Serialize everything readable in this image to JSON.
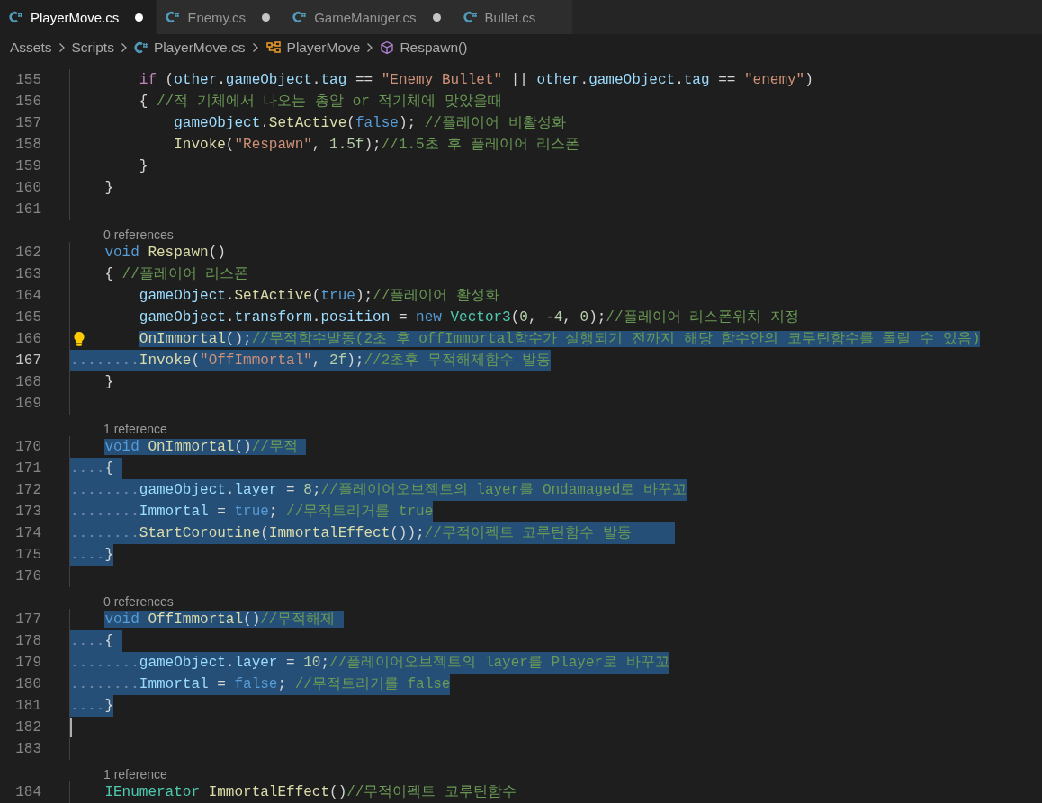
{
  "tabs": [
    {
      "label": "PlayerMove.cs",
      "selected": true,
      "modified": true
    },
    {
      "label": "Enemy.cs",
      "selected": false,
      "modified": true
    },
    {
      "label": "GameManiger.cs",
      "selected": false,
      "modified": true
    },
    {
      "label": "Bullet.cs",
      "selected": false,
      "modified": false
    }
  ],
  "breadcrumb": [
    {
      "kind": "folder",
      "label": "Assets"
    },
    {
      "kind": "folder",
      "label": "Scripts"
    },
    {
      "kind": "file",
      "label": "PlayerMove.cs"
    },
    {
      "kind": "class",
      "label": "PlayerMove"
    },
    {
      "kind": "method",
      "label": "Respawn()"
    }
  ],
  "editor": {
    "rows": [
      {
        "kind": "code",
        "number": "155",
        "selected": false,
        "active": false,
        "cursor": false,
        "lightbulb": false,
        "tokens": [
          {
            "text": "        if",
            "kind": "ctl"
          },
          {
            "text": " (",
            "kind": "p"
          },
          {
            "text": "other",
            "kind": "var"
          },
          {
            "text": ".",
            "kind": "p"
          },
          {
            "text": "gameObject",
            "kind": "var"
          },
          {
            "text": ".",
            "kind": "p"
          },
          {
            "text": "tag",
            "kind": "var"
          },
          {
            "text": " == ",
            "kind": "p"
          },
          {
            "text": "\"Enemy_Bullet\"",
            "kind": "str"
          },
          {
            "text": " || ",
            "kind": "p"
          },
          {
            "text": "other",
            "kind": "var"
          },
          {
            "text": ".",
            "kind": "p"
          },
          {
            "text": "gameObject",
            "kind": "var"
          },
          {
            "text": ".",
            "kind": "p"
          },
          {
            "text": "tag",
            "kind": "var"
          },
          {
            "text": " == ",
            "kind": "p"
          },
          {
            "text": "\"enemy\"",
            "kind": "str"
          },
          {
            "text": ")",
            "kind": "p"
          }
        ]
      },
      {
        "kind": "code",
        "number": "156",
        "selected": false,
        "active": false,
        "cursor": false,
        "lightbulb": false,
        "tokens": [
          {
            "text": "        { ",
            "kind": "p"
          },
          {
            "text": "//적 기체에서 나오는 총알 or 적기체에 맞았을때",
            "kind": "cmt"
          }
        ]
      },
      {
        "kind": "code",
        "number": "157",
        "selected": false,
        "active": false,
        "cursor": false,
        "lightbulb": false,
        "tokens": [
          {
            "text": "            gameObject",
            "kind": "var"
          },
          {
            "text": ".",
            "kind": "p"
          },
          {
            "text": "SetActive",
            "kind": "fn"
          },
          {
            "text": "(",
            "kind": "p"
          },
          {
            "text": "false",
            "kind": "kw"
          },
          {
            "text": "); ",
            "kind": "p"
          },
          {
            "text": "//플레이어 비활성화",
            "kind": "cmt"
          }
        ]
      },
      {
        "kind": "code",
        "number": "158",
        "selected": false,
        "active": false,
        "cursor": false,
        "lightbulb": false,
        "tokens": [
          {
            "text": "            Invoke",
            "kind": "fn"
          },
          {
            "text": "(",
            "kind": "p"
          },
          {
            "text": "\"Respawn\"",
            "kind": "str"
          },
          {
            "text": ", ",
            "kind": "p"
          },
          {
            "text": "1.5f",
            "kind": "num"
          },
          {
            "text": ");",
            "kind": "p"
          },
          {
            "text": "//1.5초 후 플레이어 리스폰",
            "kind": "cmt"
          }
        ]
      },
      {
        "kind": "code",
        "number": "159",
        "selected": false,
        "active": false,
        "cursor": false,
        "lightbulb": false,
        "tokens": [
          {
            "text": "        }",
            "kind": "p"
          }
        ]
      },
      {
        "kind": "code",
        "number": "160",
        "selected": false,
        "active": false,
        "cursor": false,
        "lightbulb": false,
        "tokens": [
          {
            "text": "    }",
            "kind": "p"
          }
        ]
      },
      {
        "kind": "code",
        "number": "161",
        "active": false,
        "cursor": false,
        "lightbulb": false,
        "tokens": []
      },
      {
        "kind": "codelens",
        "text": "0 references"
      },
      {
        "kind": "code",
        "number": "162",
        "selected": false,
        "active": false,
        "cursor": false,
        "lightbulb": false,
        "tokens": [
          {
            "text": "    void",
            "kind": "kw"
          },
          {
            "text": " Respawn",
            "kind": "fn"
          },
          {
            "text": "()",
            "kind": "p"
          }
        ]
      },
      {
        "kind": "code",
        "number": "163",
        "selected": false,
        "active": false,
        "cursor": false,
        "lightbulb": false,
        "tokens": [
          {
            "text": "    { ",
            "kind": "p"
          },
          {
            "text": "//플레이어 리스폰",
            "kind": "cmt"
          }
        ]
      },
      {
        "kind": "code",
        "number": "164",
        "selected": false,
        "active": false,
        "cursor": false,
        "lightbulb": false,
        "tokens": [
          {
            "text": "        gameObject",
            "kind": "var"
          },
          {
            "text": ".",
            "kind": "p"
          },
          {
            "text": "SetActive",
            "kind": "fn"
          },
          {
            "text": "(",
            "kind": "p"
          },
          {
            "text": "true",
            "kind": "kw"
          },
          {
            "text": ");",
            "kind": "p"
          },
          {
            "text": "//플레이어 활성화",
            "kind": "cmt"
          }
        ]
      },
      {
        "kind": "code",
        "number": "165",
        "selected": false,
        "active": false,
        "cursor": false,
        "lightbulb": false,
        "tokens": [
          {
            "text": "        gameObject",
            "kind": "var"
          },
          {
            "text": ".",
            "kind": "p"
          },
          {
            "text": "transform",
            "kind": "var"
          },
          {
            "text": ".",
            "kind": "p"
          },
          {
            "text": "position",
            "kind": "var"
          },
          {
            "text": " = ",
            "kind": "p"
          },
          {
            "text": "new",
            "kind": "kw"
          },
          {
            "text": " Vector3",
            "kind": "type"
          },
          {
            "text": "(",
            "kind": "p"
          },
          {
            "text": "0",
            "kind": "num"
          },
          {
            "text": ", ",
            "kind": "p"
          },
          {
            "text": "-4",
            "kind": "num"
          },
          {
            "text": ", ",
            "kind": "p"
          },
          {
            "text": "0",
            "kind": "num"
          },
          {
            "text": ");",
            "kind": "p"
          },
          {
            "text": "//플레이어 리스폰위치 지정",
            "kind": "cmt"
          }
        ]
      },
      {
        "kind": "code",
        "number": "166",
        "selected": true,
        "indent_selected": false,
        "active": false,
        "cursor": false,
        "lightbulb": true,
        "tokens": [
          {
            "text": "        OnImmortal",
            "kind": "fn"
          },
          {
            "text": "();",
            "kind": "p"
          },
          {
            "text": "//무적함수발동(2초 후 offImmortal함수가 실행되기 전까지 해당 함수안의 코루틴함수를 돌릴 수 있음)",
            "kind": "cmt"
          }
        ]
      },
      {
        "kind": "code",
        "number": "167",
        "selected": true,
        "indent_selected": true,
        "active": true,
        "cursor": false,
        "lightbulb": false,
        "tokens": [
          {
            "text": "        Invoke",
            "kind": "fn"
          },
          {
            "text": "(",
            "kind": "p"
          },
          {
            "text": "\"OffImmortal\"",
            "kind": "str"
          },
          {
            "text": ", ",
            "kind": "p"
          },
          {
            "text": "2f",
            "kind": "num"
          },
          {
            "text": ");",
            "kind": "p"
          },
          {
            "text": "//2초후 무적해제함수 발동",
            "kind": "cmt"
          }
        ]
      },
      {
        "kind": "code",
        "number": "168",
        "selected": false,
        "active": false,
        "cursor": false,
        "lightbulb": false,
        "tokens": [
          {
            "text": "    }",
            "kind": "p"
          }
        ]
      },
      {
        "kind": "code",
        "number": "169",
        "active": false,
        "cursor": false,
        "lightbulb": false,
        "tokens": []
      },
      {
        "kind": "codelens",
        "text": "1 reference"
      },
      {
        "kind": "code",
        "number": "170",
        "selected": true,
        "indent_selected": false,
        "active": false,
        "cursor": false,
        "lightbulb": false,
        "tokens": [
          {
            "text": "    void",
            "kind": "kw"
          },
          {
            "text": " OnImmortal",
            "kind": "fn"
          },
          {
            "text": "()",
            "kind": "p"
          },
          {
            "text": "//무적 ",
            "kind": "cmt"
          }
        ]
      },
      {
        "kind": "code",
        "number": "171",
        "selected": true,
        "indent_selected": true,
        "active": false,
        "cursor": false,
        "lightbulb": false,
        "tokens": [
          {
            "text": "    { ",
            "kind": "p"
          }
        ]
      },
      {
        "kind": "code",
        "number": "172",
        "selected": true,
        "indent_selected": true,
        "active": false,
        "cursor": false,
        "lightbulb": false,
        "tokens": [
          {
            "text": "        gameObject",
            "kind": "var"
          },
          {
            "text": ".",
            "kind": "p"
          },
          {
            "text": "layer",
            "kind": "var"
          },
          {
            "text": " = ",
            "kind": "p"
          },
          {
            "text": "8",
            "kind": "num"
          },
          {
            "text": ";",
            "kind": "p"
          },
          {
            "text": "//플레이어오브젝트의 layer를 Ondamaged로 바꾸꼬",
            "kind": "cmt"
          }
        ]
      },
      {
        "kind": "code",
        "number": "173",
        "selected": true,
        "indent_selected": true,
        "active": false,
        "cursor": false,
        "lightbulb": false,
        "tokens": [
          {
            "text": "        Immortal",
            "kind": "var"
          },
          {
            "text": " = ",
            "kind": "p"
          },
          {
            "text": "true",
            "kind": "kw"
          },
          {
            "text": "; ",
            "kind": "p"
          },
          {
            "text": "//무적트리거를 true",
            "kind": "cmt"
          }
        ]
      },
      {
        "kind": "code",
        "number": "174",
        "selected": true,
        "indent_selected": true,
        "active": false,
        "cursor": false,
        "lightbulb": false,
        "tokens": [
          {
            "text": "        StartCoroutine",
            "kind": "fn"
          },
          {
            "text": "(",
            "kind": "p"
          },
          {
            "text": "ImmortalEffect",
            "kind": "fn"
          },
          {
            "text": "());",
            "kind": "p"
          },
          {
            "text": "//무적이펙트 코루틴함수 발동     ",
            "kind": "cmt"
          }
        ]
      },
      {
        "kind": "code",
        "number": "175",
        "selected": true,
        "indent_selected": true,
        "active": false,
        "cursor": false,
        "lightbulb": false,
        "tokens": [
          {
            "text": "    }",
            "kind": "p"
          }
        ]
      },
      {
        "kind": "code",
        "number": "176",
        "active": false,
        "cursor": false,
        "lightbulb": false,
        "tokens": []
      },
      {
        "kind": "codelens",
        "text": "0 references"
      },
      {
        "kind": "code",
        "number": "177",
        "selected": true,
        "indent_selected": false,
        "active": false,
        "cursor": false,
        "lightbulb": false,
        "tokens": [
          {
            "text": "    void",
            "kind": "kw"
          },
          {
            "text": " OffImmortal",
            "kind": "fn"
          },
          {
            "text": "()",
            "kind": "p"
          },
          {
            "text": "//무적해제 ",
            "kind": "cmt"
          }
        ]
      },
      {
        "kind": "code",
        "number": "178",
        "selected": true,
        "indent_selected": true,
        "active": false,
        "cursor": false,
        "lightbulb": false,
        "tokens": [
          {
            "text": "    { ",
            "kind": "p"
          }
        ]
      },
      {
        "kind": "code",
        "number": "179",
        "selected": true,
        "indent_selected": true,
        "active": false,
        "cursor": false,
        "lightbulb": false,
        "tokens": [
          {
            "text": "        gameObject",
            "kind": "var"
          },
          {
            "text": ".",
            "kind": "p"
          },
          {
            "text": "layer",
            "kind": "var"
          },
          {
            "text": " = ",
            "kind": "p"
          },
          {
            "text": "10",
            "kind": "num"
          },
          {
            "text": ";",
            "kind": "p"
          },
          {
            "text": "//플레이어오브젝트의 layer를 Player로 바꾸꼬",
            "kind": "cmt"
          }
        ]
      },
      {
        "kind": "code",
        "number": "180",
        "selected": true,
        "indent_selected": true,
        "active": false,
        "cursor": false,
        "lightbulb": false,
        "tokens": [
          {
            "text": "        Immortal",
            "kind": "var"
          },
          {
            "text": " = ",
            "kind": "p"
          },
          {
            "text": "false",
            "kind": "kw"
          },
          {
            "text": "; ",
            "kind": "p"
          },
          {
            "text": "//무적트리거를 false",
            "kind": "cmt"
          }
        ]
      },
      {
        "kind": "code",
        "number": "181",
        "selected": true,
        "indent_selected": true,
        "active": false,
        "cursor": false,
        "lightbulb": false,
        "tokens": [
          {
            "text": "    }",
            "kind": "p"
          }
        ]
      },
      {
        "kind": "code",
        "number": "182",
        "active": false,
        "cursor": true,
        "lightbulb": false,
        "tokens": []
      },
      {
        "kind": "code",
        "number": "183",
        "active": false,
        "cursor": false,
        "lightbulb": false,
        "tokens": []
      },
      {
        "kind": "codelens",
        "text": "1 reference"
      },
      {
        "kind": "code",
        "number": "184",
        "selected": false,
        "active": false,
        "cursor": false,
        "lightbulb": false,
        "tokens": [
          {
            "text": "    IEnumerator",
            "kind": "type"
          },
          {
            "text": " ImmortalEffect",
            "kind": "fn"
          },
          {
            "text": "()",
            "kind": "p"
          },
          {
            "text": "//무적이펙트 코루틴함수",
            "kind": "cmt"
          }
        ]
      }
    ]
  }
}
